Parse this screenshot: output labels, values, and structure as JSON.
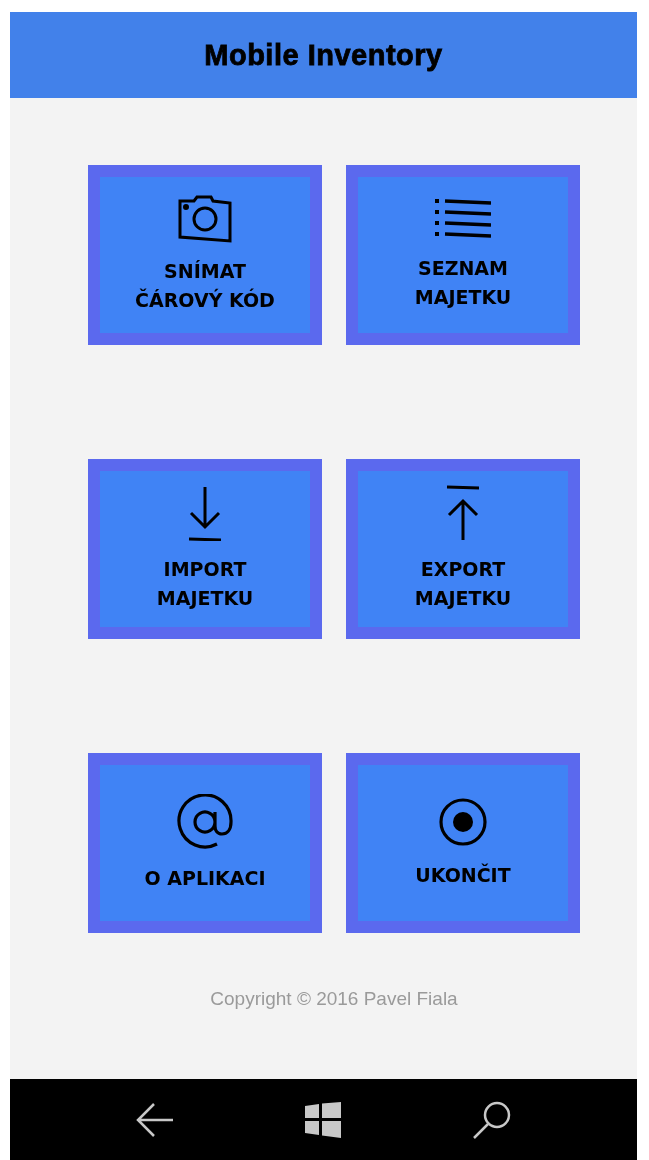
{
  "header": {
    "title": "Mobile Inventory"
  },
  "tiles": [
    {
      "kind": "camera",
      "label": "SNÍMAT\nČÁROVÝ KÓD"
    },
    {
      "kind": "list",
      "label": "SEZNAM\nMAJETKU"
    },
    {
      "kind": "download",
      "label": "IMPORT\nMAJETKU"
    },
    {
      "kind": "upload",
      "label": "EXPORT\nMAJETKU"
    },
    {
      "kind": "at",
      "label": "O APLIKACI"
    },
    {
      "kind": "record",
      "label": "UKONČIT"
    }
  ],
  "footer": {
    "copyright": "Copyright © 2016 Pavel Fiala"
  },
  "nav_bar": [
    {
      "kind": "back"
    },
    {
      "kind": "windows"
    },
    {
      "kind": "search"
    }
  ]
}
